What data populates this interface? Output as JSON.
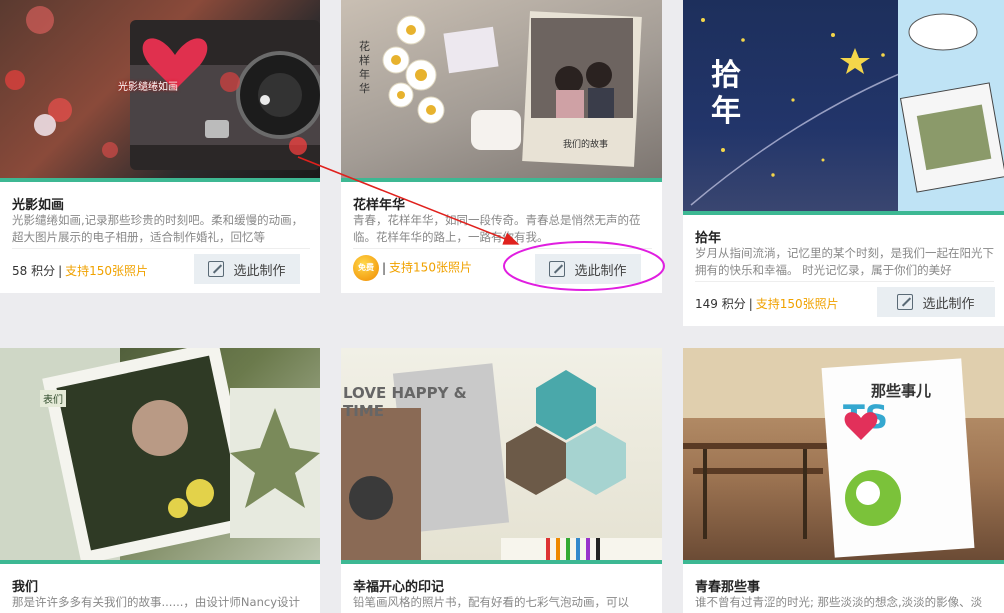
{
  "cards": [
    {
      "title": "光影如画",
      "desc": "光影缱绻如画,记录那些珍贵的时刻吧。柔和缓慢的动画，超大图片展示的电子相册，适合制作婚礼，回忆等",
      "points": "58 积分",
      "support": "支持150张照片",
      "button": "选此制作",
      "image_text": "光影缱绻如画"
    },
    {
      "title": "花样年华",
      "desc": "青春，花样年华，如同一段传奇。青春总是悄然无声的莅临。花样年华的路上，一路有你有我。",
      "free_badge": "免费",
      "support": "支持150张照片",
      "button": "选此制作",
      "image_text": "花样年华",
      "book_text": "我们的故事"
    },
    {
      "title": "拾年",
      "desc": "岁月从指间流淌，记忆里的某个时刻，是我们一起在阳光下拥有的快乐和幸福。 时光记忆录，属于你们的美好",
      "points": "149 积分",
      "support": "支持150张照片",
      "button": "选此制作",
      "image_text": "拾年"
    },
    {
      "title": "我们",
      "desc": "那是许许多多有关我们的故事......，由设计师Nancy设计",
      "image_text": "表们"
    },
    {
      "title": "幸福开心的印记",
      "desc": "铅笔画风格的照片书，配有好看的七彩气泡动画，可以",
      "image_text": "LOVE HAPPY & TIME"
    },
    {
      "title": "青春那些事",
      "desc": "谁不曾有过青涩的时光; 那些淡淡的想念,淡淡的影像、淡",
      "image_text": "那些事儿"
    }
  ]
}
